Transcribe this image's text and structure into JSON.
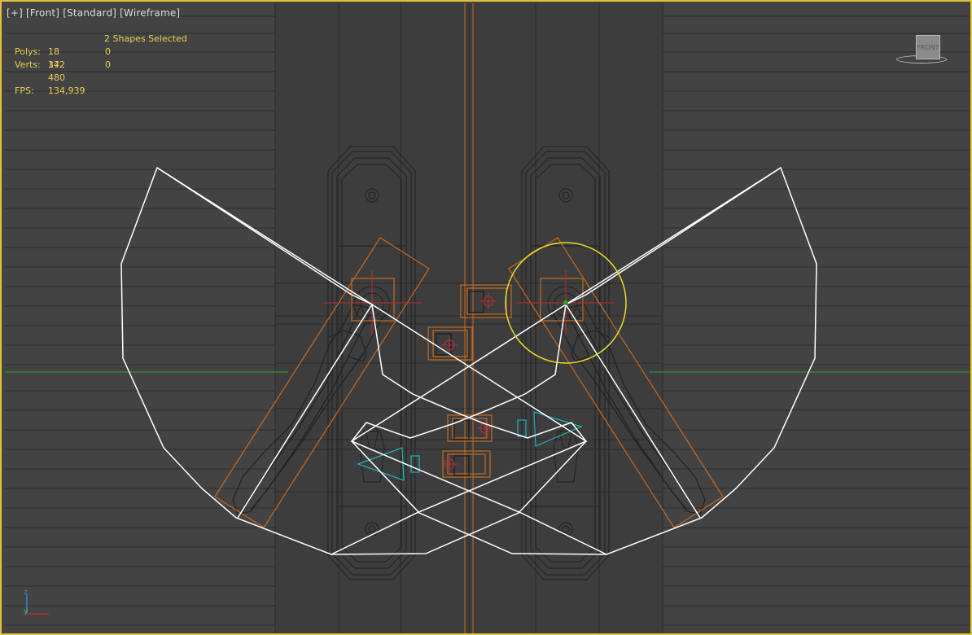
{
  "viewport": {
    "labels": [
      "[+]",
      "[Front]",
      "[Standard]",
      "[Wireframe]"
    ],
    "selection_text": "2 Shapes Selected",
    "stats": [
      {
        "key": "Polys:",
        "value": "18 372",
        "selected": "0"
      },
      {
        "key": "Verts:",
        "value": "14 480",
        "selected": "0"
      }
    ],
    "fps_label": "FPS:",
    "fps_value": "134,939",
    "viewcube_label": "FRONT",
    "axis_labels": {
      "z": "z",
      "y": "y"
    }
  },
  "colors": {
    "background": "#444444",
    "viewport_border": "#e1c33a",
    "stats_text": "#e7cf57",
    "wire_dark": "#2a2a2a",
    "selected_shape": "#ffffff",
    "orange_bbox": "#c56a23",
    "cyan_gizmo": "#22b4b4",
    "green_axis": "#2aa52a",
    "gizmo_circle": "#e8dc2c",
    "red_pivot": "#b83030"
  }
}
